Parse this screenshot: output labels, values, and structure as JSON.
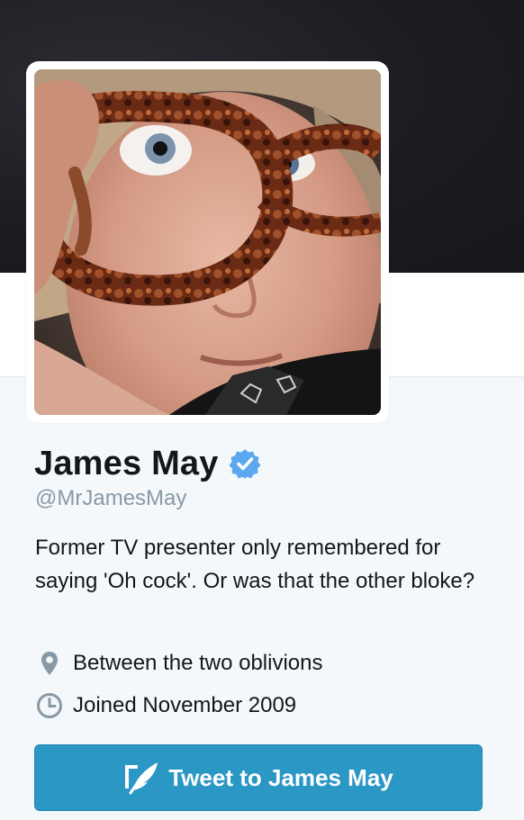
{
  "profile": {
    "name": "James May",
    "screen_name": "@MrJamesMay",
    "bio": "Former TV presenter only remembered for saying 'Oh cock'. Or was that the other bloke?",
    "location": "Between the two oblivions",
    "joined": "Joined November 2009",
    "verified": true
  },
  "actions": {
    "tweet_to_label": "Tweet to James May"
  },
  "icons": {
    "verified": "verified-badge-icon",
    "location": "location-pin-icon",
    "joined": "clock-icon",
    "tweet": "compose-quill-icon"
  },
  "colors": {
    "accent": "#2b97c4",
    "verified_blue": "#5ca8f0",
    "muted": "#8899a6",
    "text": "#14171a"
  }
}
